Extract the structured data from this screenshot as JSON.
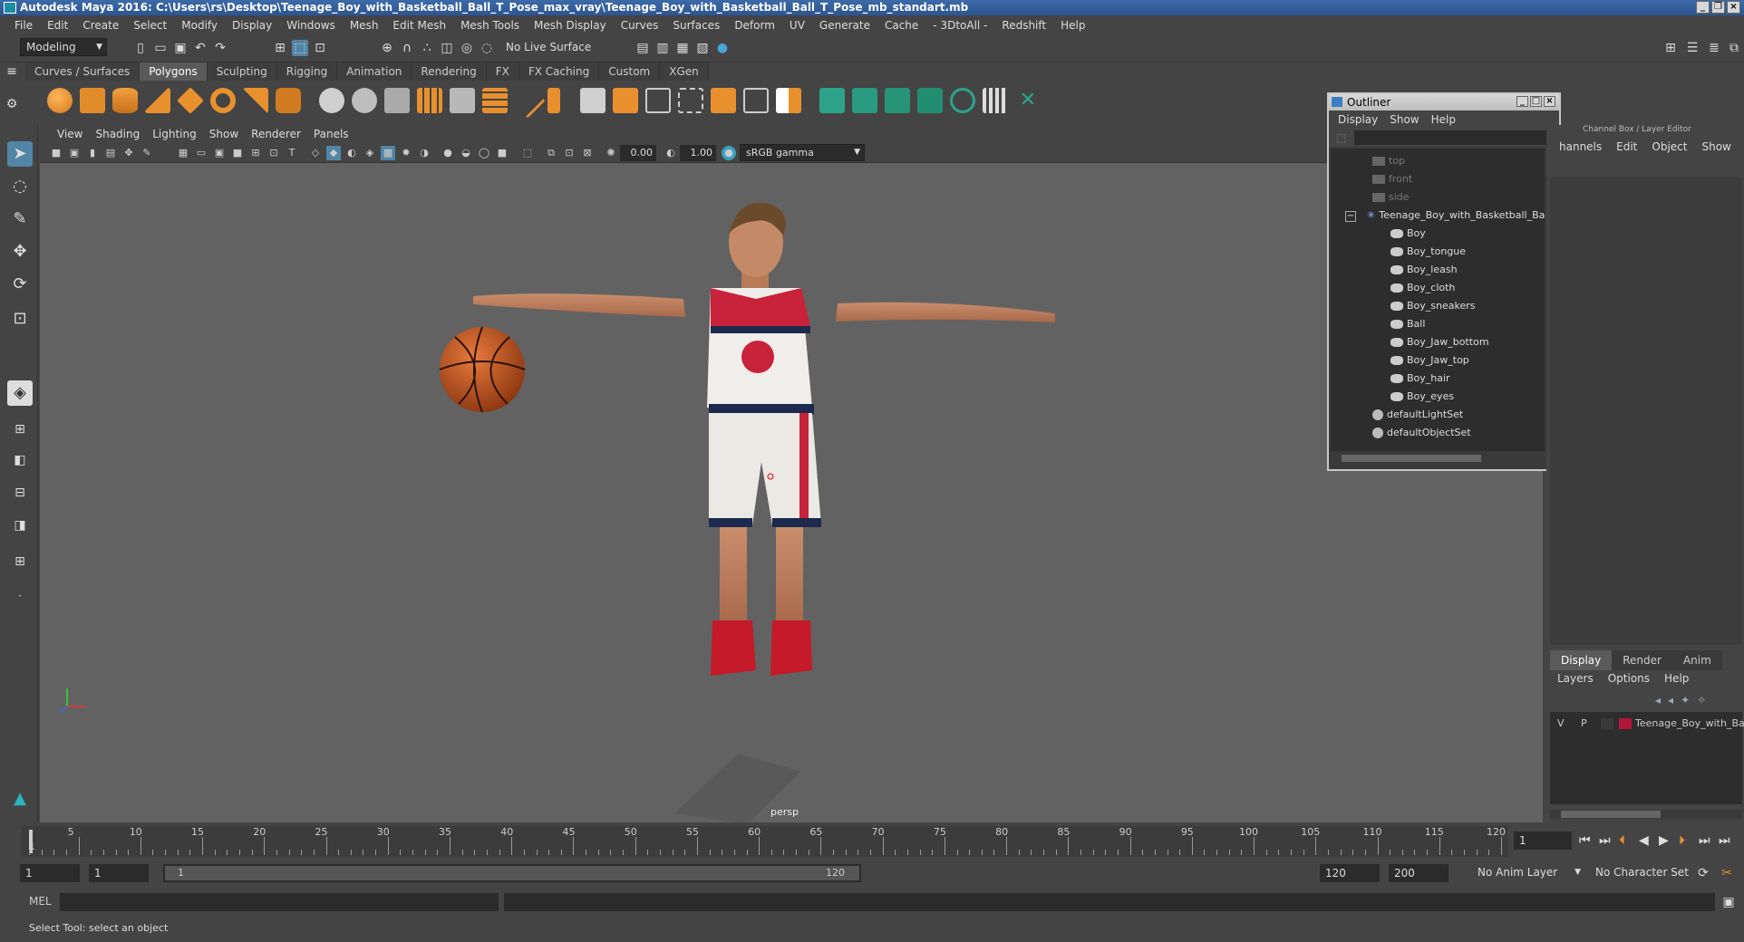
{
  "title_bar": {
    "title": "Autodesk Maya 2016: C:\\Users\\rs\\Desktop\\Teenage_Boy_with_Basketball_Ball_T_Pose_max_vray\\Teenage_Boy_with_Basketball_Ball_T_Pose_mb_standart.mb"
  },
  "menu_bar": {
    "items": [
      "File",
      "Edit",
      "Create",
      "Select",
      "Modify",
      "Display",
      "Windows",
      "Mesh",
      "Edit Mesh",
      "Mesh Tools",
      "Mesh Display",
      "Curves",
      "Surfaces",
      "Deform",
      "UV",
      "Generate",
      "Cache",
      "- 3DtoAll -",
      "Redshift",
      "Help"
    ]
  },
  "status_line": {
    "mode": "Modeling",
    "live_surface": "No Live Surface"
  },
  "shelf": {
    "tabs": [
      "Curves / Surfaces",
      "Polygons",
      "Sculpting",
      "Rigging",
      "Animation",
      "Rendering",
      "FX",
      "FX Caching",
      "Custom",
      "XGen"
    ],
    "active_tab": "Polygons"
  },
  "viewport": {
    "menu": [
      "View",
      "Shading",
      "Lighting",
      "Show",
      "Renderer",
      "Panels"
    ],
    "exposure": "0.00",
    "gamma": "1.00",
    "color_space": "sRGB gamma",
    "camera_label": "persp"
  },
  "outliner": {
    "title": "Outliner",
    "menu": [
      "Display",
      "Show",
      "Help"
    ],
    "items": [
      {
        "label": "top",
        "dim": true,
        "indent": 0
      },
      {
        "label": "front",
        "dim": true,
        "indent": 0
      },
      {
        "label": "side",
        "dim": true,
        "indent": 0
      },
      {
        "label": "Teenage_Boy_with_Basketball_Ba",
        "dim": false,
        "indent": 0
      },
      {
        "label": "Boy",
        "dim": false,
        "indent": 1
      },
      {
        "label": "Boy_tongue",
        "dim": false,
        "indent": 1
      },
      {
        "label": "Boy_leash",
        "dim": false,
        "indent": 1
      },
      {
        "label": "Boy_cloth",
        "dim": false,
        "indent": 1
      },
      {
        "label": "Boy_sneakers",
        "dim": false,
        "indent": 1
      },
      {
        "label": "Ball",
        "dim": false,
        "indent": 1
      },
      {
        "label": "Boy_Jaw_bottom",
        "dim": false,
        "indent": 1
      },
      {
        "label": "Boy_Jaw_top",
        "dim": false,
        "indent": 1
      },
      {
        "label": "Boy_hair",
        "dim": false,
        "indent": 1
      },
      {
        "label": "Boy_eyes",
        "dim": false,
        "indent": 1
      },
      {
        "label": "defaultLightSet",
        "dim": false,
        "indent": 0
      },
      {
        "label": "defaultObjectSet",
        "dim": false,
        "indent": 0
      }
    ]
  },
  "channel_box": {
    "header": "Channel Box / Layer Editor",
    "tabs": [
      "hannels",
      "Edit",
      "Object",
      "Show"
    ]
  },
  "layer_editor": {
    "tabs": [
      "Display",
      "Render",
      "Anim"
    ],
    "active_tab": "Display",
    "menu": [
      "Layers",
      "Options",
      "Help"
    ],
    "layer": {
      "v": "V",
      "p": "P",
      "name": "Teenage_Boy_with_Ba:",
      "color": "#b3163a"
    }
  },
  "timeline": {
    "ticks": [
      "5",
      "10",
      "15",
      "20",
      "25",
      "30",
      "35",
      "40",
      "45",
      "50",
      "55",
      "60",
      "65",
      "70",
      "75",
      "80",
      "85",
      "90",
      "95",
      "100",
      "105",
      "110",
      "115",
      "120"
    ],
    "start_label": "1",
    "current_frame": "1"
  },
  "range": {
    "start": "1",
    "anim_start": "1",
    "slider_start": "1",
    "slider_end": "120",
    "end": "120",
    "anim_end": "200",
    "anim_layer": "No Anim Layer",
    "character_set": "No Character Set"
  },
  "command_line": {
    "label": "MEL"
  },
  "help_line": {
    "text": "Select Tool: select an object"
  },
  "colors": {
    "accent": "#5285a6",
    "viewport_bg": "#626262",
    "panel_bg": "#444444",
    "field_bg": "#2b2b2b"
  }
}
